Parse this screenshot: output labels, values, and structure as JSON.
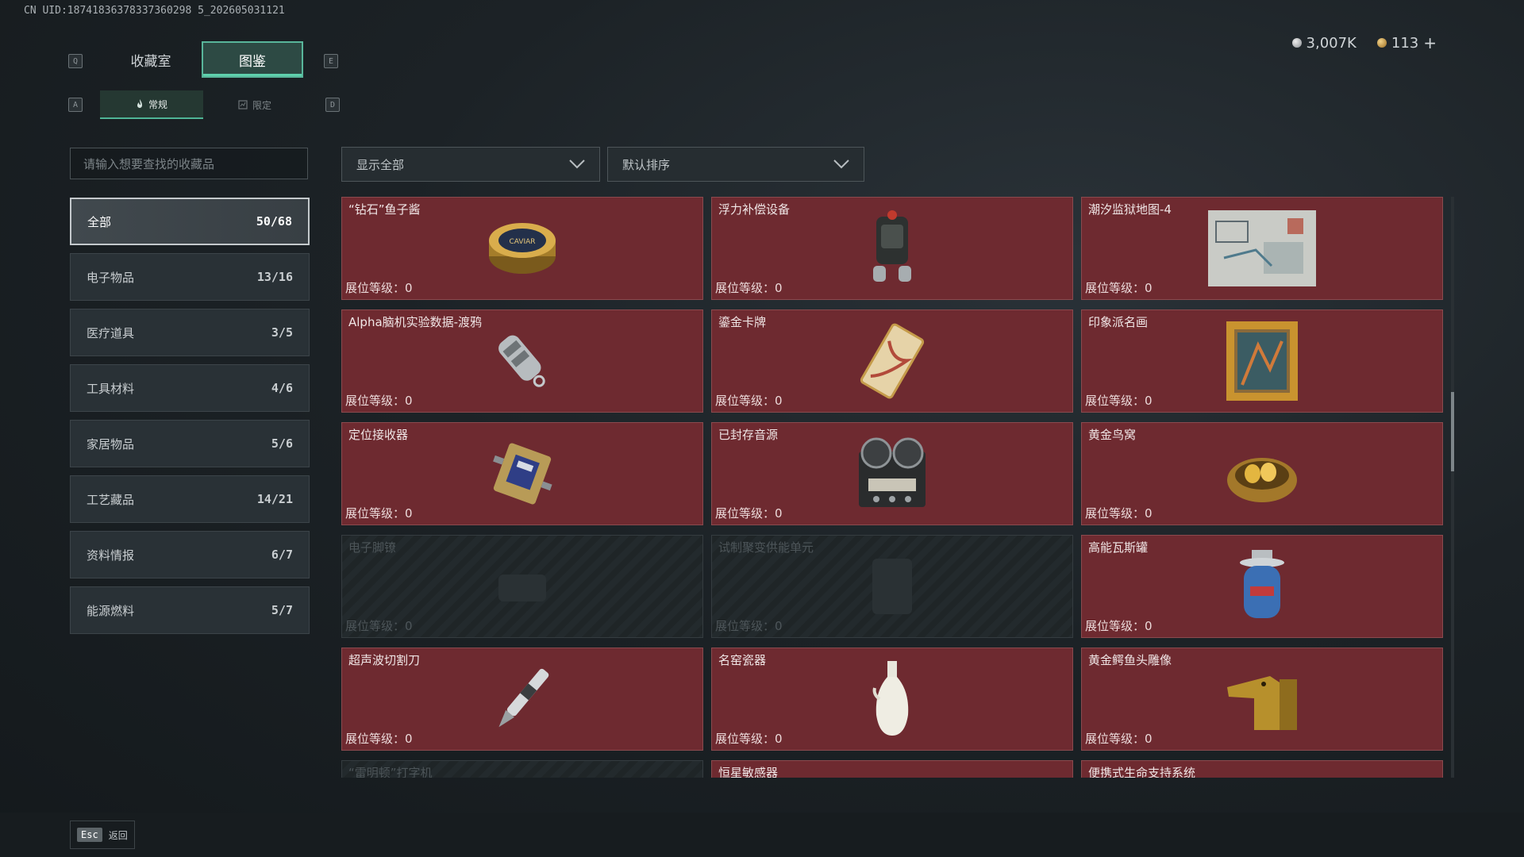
{
  "uid": "CN UID:18741836378337360298 5_202605031121",
  "currency": {
    "silver": "3,007K",
    "gold": "113",
    "plus": "+"
  },
  "keys": {
    "q": "Q",
    "e": "E",
    "a": "A",
    "d": "D"
  },
  "tabs": [
    {
      "label": "收藏室"
    },
    {
      "label": "图鉴"
    }
  ],
  "subtabs": [
    {
      "label": "常规"
    },
    {
      "label": "限定"
    }
  ],
  "search": {
    "placeholder": "请输入想要查找的收藏品"
  },
  "categories": [
    {
      "label": "全部",
      "count": "50/68"
    },
    {
      "label": "电子物品",
      "count": "13/16"
    },
    {
      "label": "医疗道具",
      "count": "3/5"
    },
    {
      "label": "工具材料",
      "count": "4/6"
    },
    {
      "label": "家居物品",
      "count": "5/6"
    },
    {
      "label": "工艺藏品",
      "count": "14/21"
    },
    {
      "label": "资料情报",
      "count": "6/7"
    },
    {
      "label": "能源燃料",
      "count": "5/7"
    }
  ],
  "filters": {
    "show": "显示全部",
    "sort": "默认排序"
  },
  "level_label": "展位等级：",
  "items": [
    {
      "name": "“钻石”鱼子酱",
      "level": "0",
      "icon": "caviar-icon"
    },
    {
      "name": "浮力补偿设备",
      "level": "0",
      "icon": "bcd-icon"
    },
    {
      "name": "潮汐监狱地图-4",
      "level": "0",
      "icon": "map-icon"
    },
    {
      "name": "Alpha脑机实验数据-渡鸦",
      "level": "0",
      "icon": "usb-drive-icon"
    },
    {
      "name": "鎏金卡牌",
      "level": "0",
      "icon": "card-icon"
    },
    {
      "name": "印象派名画",
      "level": "0",
      "icon": "painting-icon"
    },
    {
      "name": "定位接收器",
      "level": "0",
      "icon": "receiver-icon"
    },
    {
      "name": "已封存音源",
      "level": "0",
      "icon": "reel-recorder-icon"
    },
    {
      "name": "黄金鸟窝",
      "level": "0",
      "icon": "golden-nest-icon"
    },
    {
      "name": "电子脚镣",
      "level": "0",
      "icon": "ankle-monitor-icon"
    },
    {
      "name": "试制聚变供能单元",
      "level": "0",
      "icon": "fusion-cell-icon"
    },
    {
      "name": "高能瓦斯罐",
      "level": "0",
      "icon": "gas-canister-icon"
    },
    {
      "name": "超声波切割刀",
      "level": "0",
      "icon": "cutter-icon"
    },
    {
      "name": "名窑瓷器",
      "level": "0",
      "icon": "vase-icon"
    },
    {
      "name": "黄金鳄鱼头雕像",
      "level": "0",
      "icon": "croc-statue-icon"
    },
    {
      "name": "“雷明顿”打字机",
      "level": "",
      "icon": "typewriter-icon"
    },
    {
      "name": "恒星敏感器",
      "level": "",
      "icon": "star-sensor-icon"
    },
    {
      "name": "便携式生命支持系统",
      "level": "",
      "icon": "life-support-icon"
    }
  ],
  "footer": {
    "key": "Esc",
    "label": "返回"
  }
}
